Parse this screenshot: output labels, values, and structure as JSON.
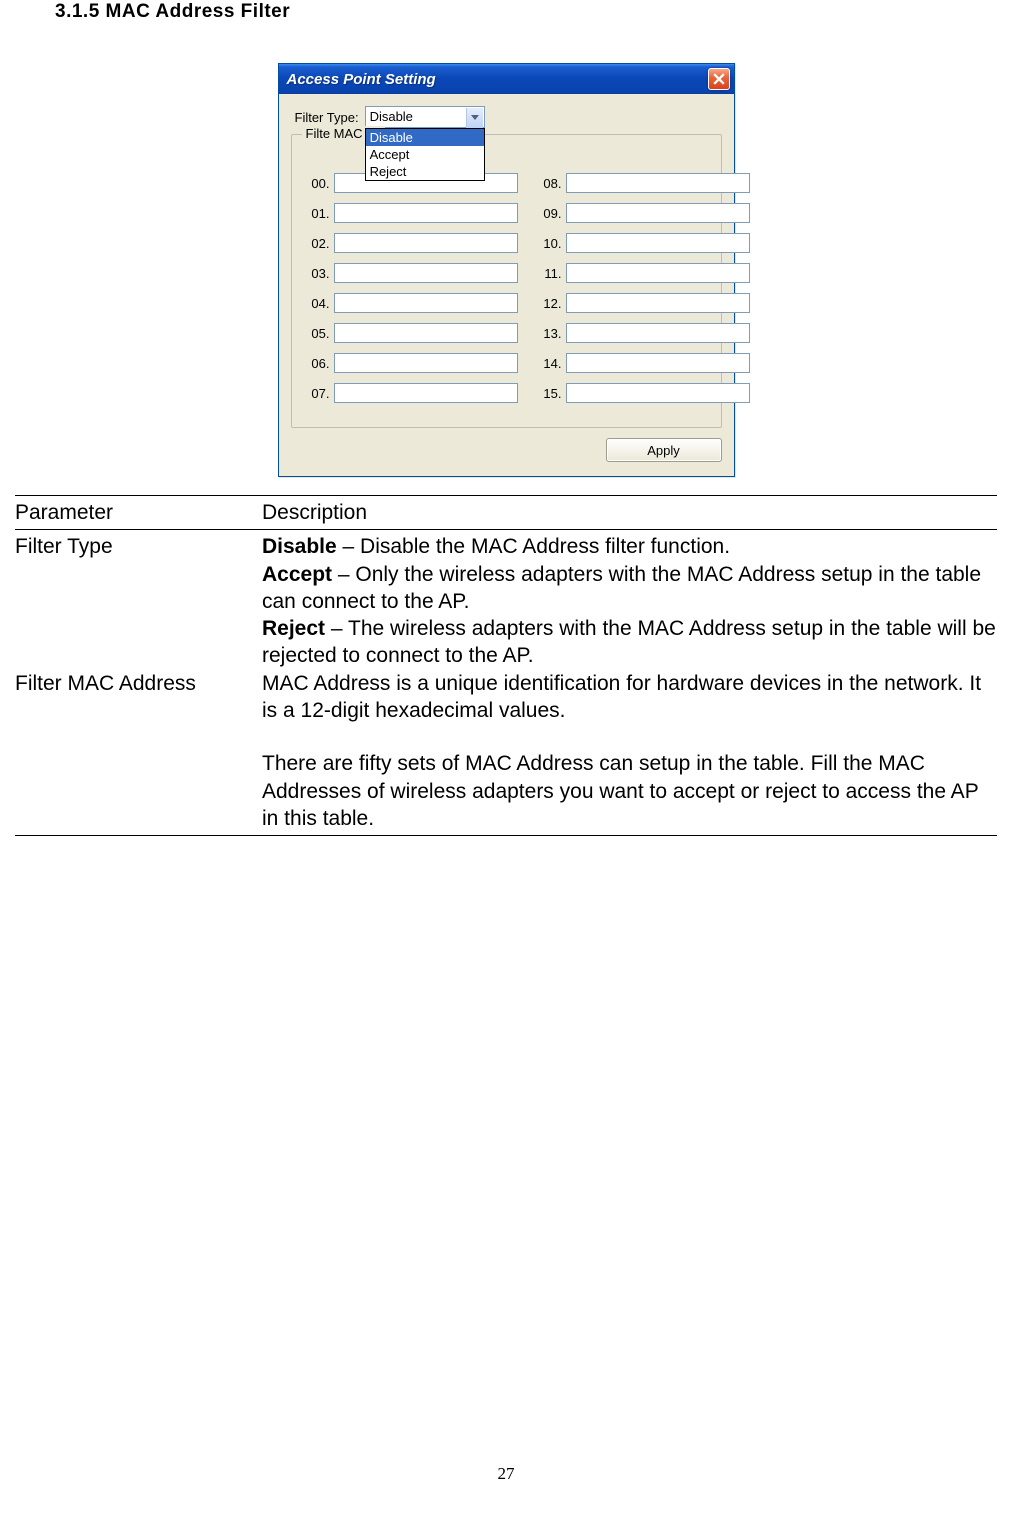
{
  "heading": "3.1.5  MAC Address Filter",
  "dialog": {
    "title": "Access Point Setting",
    "filter_type_label": "Filter Type:",
    "combo_value": "Disable",
    "dropdown_options": [
      "Disable",
      "Accept",
      "Reject"
    ],
    "groupbox_legend": "Filte MAC Ad",
    "left_labels": [
      "00.",
      "01.",
      "02.",
      "03.",
      "04.",
      "05.",
      "06.",
      "07."
    ],
    "right_labels": [
      "08.",
      "09.",
      "10.",
      "11.",
      "12.",
      "13.",
      "14.",
      "15."
    ],
    "apply_label": "Apply"
  },
  "table": {
    "header_param": "Parameter",
    "header_desc": "Description",
    "row1_param": "Filter Type",
    "row1_disable_bold": "Disable",
    "row1_disable_text": " – Disable the MAC Address filter function.",
    "row1_accept_bold": "Accept",
    "row1_accept_text": " – Only the wireless adapters with the MAC Address setup in the table can connect to the AP.",
    "row1_reject_bold": "Reject",
    "row1_reject_text": " – The wireless adapters with the MAC Address setup in the table will be rejected to connect to the AP.",
    "row2_param": "Filter MAC Address",
    "row2_text1": "MAC Address is a unique identification for hardware devices in the network. It is a 12-digit hexadecimal values.",
    "row2_text2": "There are fifty sets of MAC Address can setup in the table. Fill the MAC Addresses of wireless adapters you want to accept or reject to access the AP in this table."
  },
  "page_number": "27"
}
